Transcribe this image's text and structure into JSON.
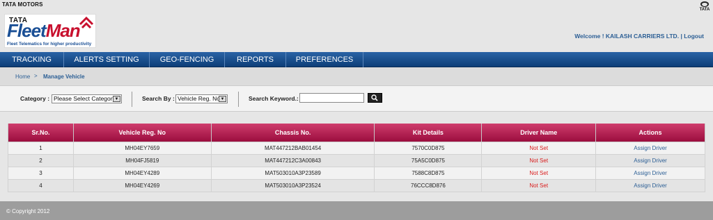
{
  "brand": {
    "tata_motors": "TATA MOTORS",
    "logo_tata": "TATA",
    "logo_fleet": "Fleet",
    "logo_man": "Man",
    "tagline": "Fleet Telematics for higher productivity",
    "tata_mark_text": "TATA"
  },
  "header": {
    "welcome": "Welcome ! KAILASH CARRIERS LTD.",
    "separator": "|",
    "logout": "Logout"
  },
  "nav": [
    "TRACKING",
    "ALERTS SETTING",
    "GEO-FENCING",
    "REPORTS",
    "PREFERENCES"
  ],
  "breadcrumb": {
    "home": "Home",
    "separator": ">",
    "current": "Manage Vehicle"
  },
  "filters": {
    "category_label": "Category :",
    "category_value": "Please Select Category",
    "search_by_label": "Search By :",
    "search_by_value": "Vehicle Reg. No",
    "keyword_label": "Search Keyword.:",
    "keyword_value": ""
  },
  "table": {
    "headers": [
      "Sr.No.",
      "Vehicle Reg. No",
      "Chassis No.",
      "Kit Details",
      "Driver Name",
      "Actions"
    ],
    "rows": [
      [
        "1",
        "MH04EY7659",
        "MAT447212BAB01454",
        "7570C0D875",
        "Not Set",
        "Assign Driver"
      ],
      [
        "2",
        "MH04FJ5819",
        "MAT447212C3A00843",
        "75A5C0D875",
        "Not Set",
        "Assign Driver"
      ],
      [
        "3",
        "MH04EY4289",
        "MAT503010A3P23589",
        "7588C8D875",
        "Not Set",
        "Assign Driver"
      ],
      [
        "4",
        "MH04EY4269",
        "MAT503010A3P23524",
        "76CCC8D876",
        "Not Set",
        "Assign Driver"
      ]
    ]
  },
  "footer": {
    "copyright": "© Copyright 2012"
  },
  "colors": {
    "nav_blue": "#1a4f95",
    "table_header_maroon": "#b41d4f",
    "not_set_red": "#d91a1a",
    "link_blue": "#2c5f95"
  }
}
